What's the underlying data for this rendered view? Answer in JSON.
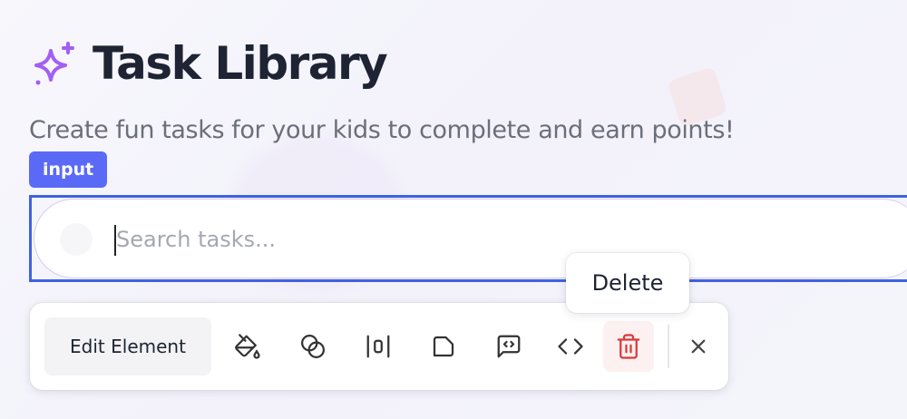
{
  "header": {
    "title": "Task Library",
    "icon": "sparkle-icon",
    "subtitle": "Create fun tasks for your kids to complete and earn points!"
  },
  "element_tag": "input",
  "search": {
    "placeholder": "Search tasks...",
    "value": ""
  },
  "toolbar": {
    "edit_label": "Edit Element",
    "tools": [
      {
        "icon": "paint-bucket-icon"
      },
      {
        "icon": "blend-circles-icon"
      },
      {
        "icon": "align-center-icon"
      },
      {
        "icon": "corner-radius-icon"
      },
      {
        "icon": "message-code-icon"
      },
      {
        "icon": "code-icon"
      },
      {
        "icon": "trash-icon"
      }
    ],
    "close_icon": "close-icon"
  },
  "tooltip": "Delete",
  "colors": {
    "accent": "#5b6af6",
    "selection_outline": "#3d63dd",
    "sparkle": "#a25ef5",
    "delete": "#d93a3a"
  }
}
